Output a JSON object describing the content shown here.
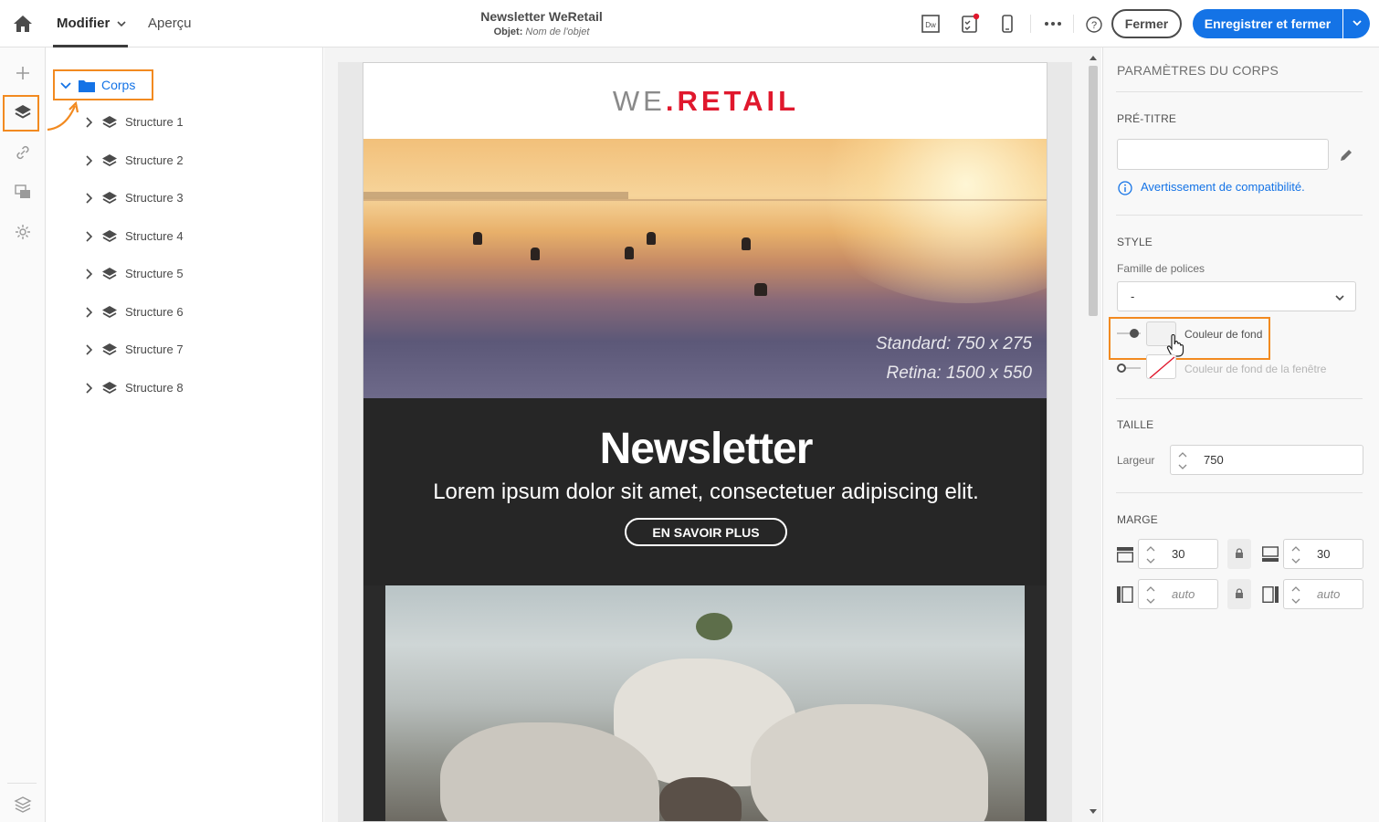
{
  "header": {
    "tabs": [
      {
        "label": "Modifier",
        "active": true
      },
      {
        "label": "Aperçu",
        "active": false
      }
    ],
    "doc_title": "Newsletter WeRetail",
    "subject_label": "Objet:",
    "subject_value": "Nom de l'objet",
    "close_label": "Fermer",
    "save_label": "Enregistrer et fermer",
    "dw_icon_text": "Dw"
  },
  "tree": {
    "root_label": "Corps",
    "items": [
      {
        "label": "Structure 1"
      },
      {
        "label": "Structure 2"
      },
      {
        "label": "Structure 3"
      },
      {
        "label": "Structure 4"
      },
      {
        "label": "Structure 5"
      },
      {
        "label": "Structure 6"
      },
      {
        "label": "Structure 7"
      },
      {
        "label": "Structure 8"
      }
    ]
  },
  "email": {
    "logo_we": "WE",
    "logo_dot": ".",
    "logo_retail": "RETAIL",
    "hero_dim_standard": "Standard: 750 x 275",
    "hero_dim_retina": "Retina: 1500 x 550",
    "news_title": "Newsletter",
    "news_text": "Lorem ipsum dolor sit amet, consectetuer adipiscing elit.",
    "news_button": "EN SAVOIR PLUS"
  },
  "props": {
    "panel_title": "PARAMÈTRES DU CORPS",
    "pretitle_section": "PRÉ-TITRE",
    "pretitle_value": "",
    "compat_link": "Avertissement de compatibilité.",
    "style_section": "STYLE",
    "font_family_label": "Famille de polices",
    "font_family_value": "-",
    "bg_color_label": "Couleur de fond",
    "window_bg_color_label": "Couleur de fond de la fenêtre",
    "size_section": "TAILLE",
    "width_label": "Largeur",
    "width_value": "750",
    "margin_section": "MARGE",
    "margin_top": "30",
    "margin_bottom": "30",
    "margin_left_placeholder": "auto",
    "margin_right_placeholder": "auto"
  },
  "colors": {
    "accent": "#1473e6",
    "annotation": "#f28a20",
    "logo_red": "#e0182d",
    "news_bg": "#262626"
  }
}
